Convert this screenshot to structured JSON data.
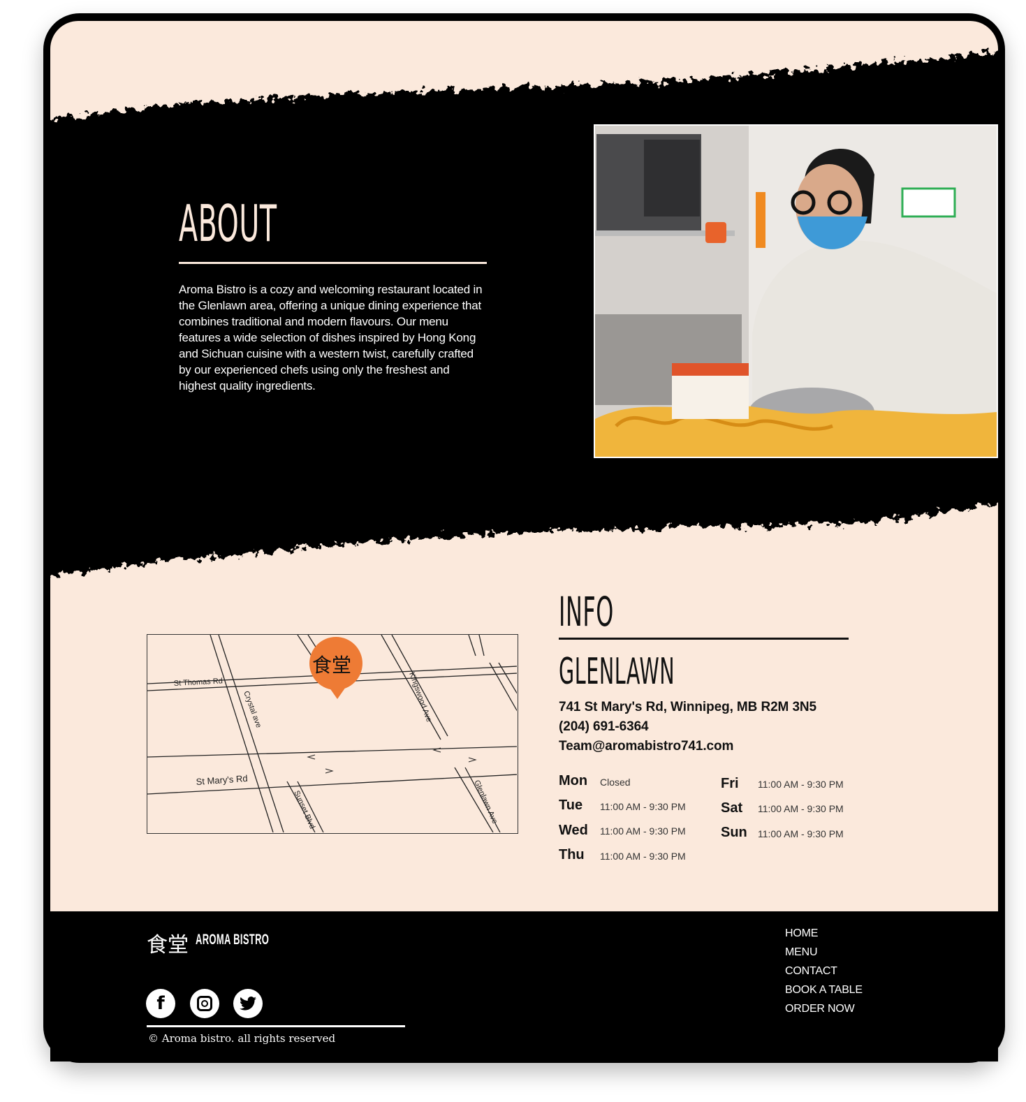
{
  "about": {
    "title": "ABOUT",
    "body": "Aroma Bistro is a cozy and welcoming restaurant located in the Glenlawn area, offering a unique dining experience that combines traditional and modern flavours. Our menu features a wide selection of dishes inspired by Hong Kong and Sichuan cuisine with a western twist, carefully crafted by our experienced chefs using only the freshest and highest quality ingredients."
  },
  "info": {
    "title": "INFO",
    "location": "GLENLAWN",
    "address": "741 St Mary's Rd, Winnipeg, MB R2M 3N5",
    "phone": "(204) 691-6364",
    "email": "Team@aromabistro741.com"
  },
  "map": {
    "marker_glyph": "食堂",
    "streets": [
      "St Thomas Rd",
      "Crystal ave",
      "Kingswood Ave",
      "St Mary's Rd",
      "Sunset Blvd",
      "Glenlawn Ave"
    ]
  },
  "hours": {
    "left": [
      {
        "day": "Mon",
        "time": "Closed"
      },
      {
        "day": "Tue",
        "time": "11:00 AM - 9:30 PM"
      },
      {
        "day": "Wed",
        "time": "11:00 AM - 9:30 PM"
      },
      {
        "day": "Thu",
        "time": "11:00 AM - 9:30 PM"
      }
    ],
    "right": [
      {
        "day": "Fri",
        "time": "11:00 AM - 9:30 PM"
      },
      {
        "day": "Sat",
        "time": "11:00 AM - 9:30 PM"
      },
      {
        "day": "Sun",
        "time": "11:00 AM - 9:30 PM"
      }
    ]
  },
  "footer": {
    "logo_glyph": "食堂",
    "logo_text": "AROMA BISTRO",
    "social": [
      {
        "icon": "facebook-icon",
        "glyph": "f"
      },
      {
        "icon": "instagram-icon",
        "glyph": "◎"
      },
      {
        "icon": "twitter-icon",
        "glyph": "🐦"
      }
    ],
    "copyright": "© Aroma bistro. all rights reserved",
    "nav": [
      "HOME",
      "MENU",
      "CONTACT",
      "BOOK A TABLE",
      "ORDER NOW"
    ]
  },
  "colors": {
    "cream": "#fbe9dc",
    "black": "#000000",
    "marker": "#ee7b35"
  }
}
